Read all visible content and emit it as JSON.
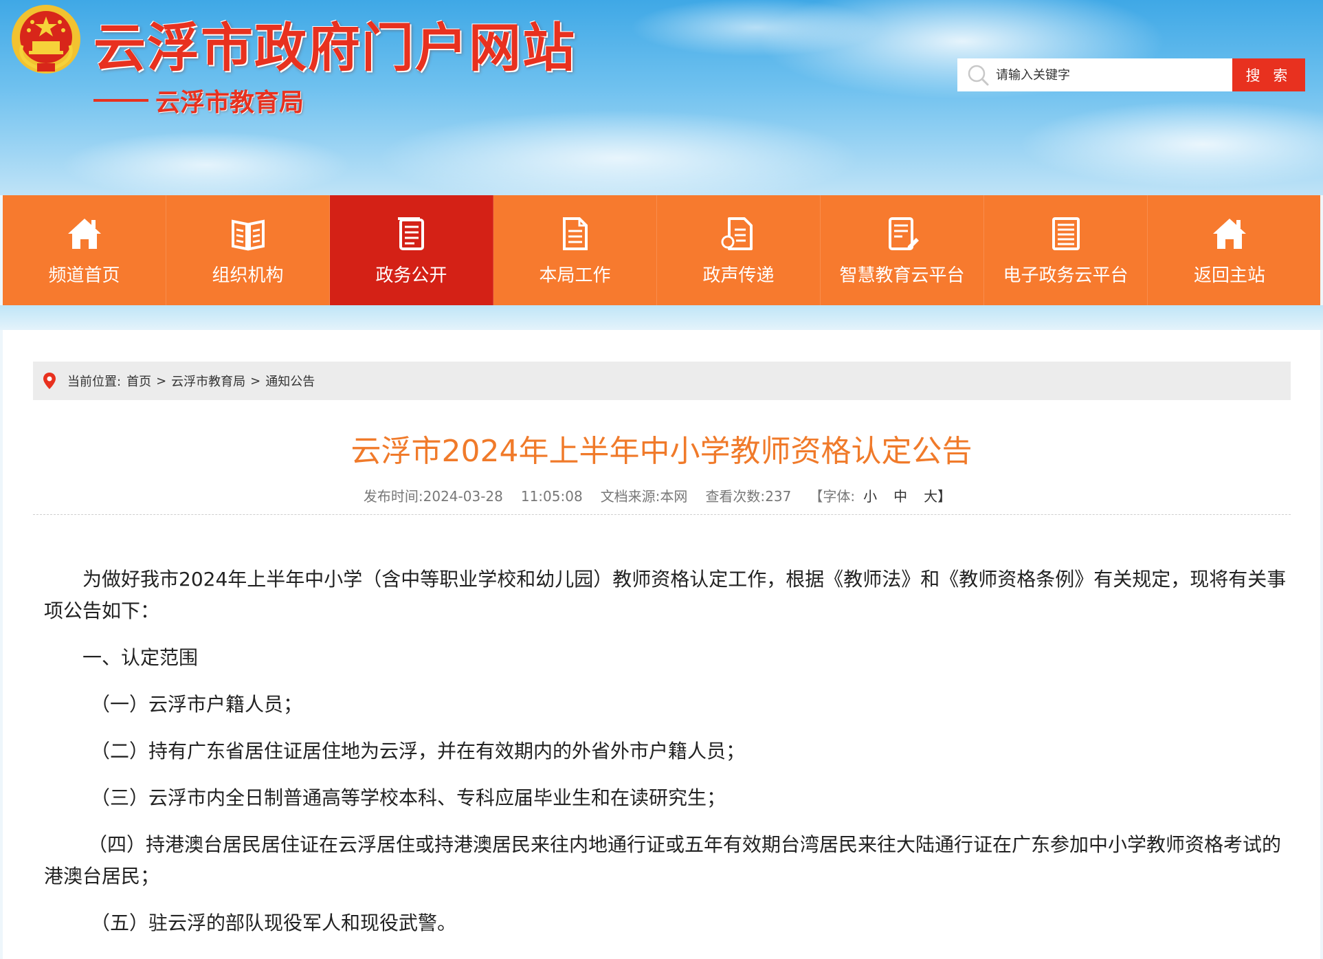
{
  "header": {
    "site_title": "云浮市政府门户网站",
    "sub_title": "云浮市教育局",
    "search": {
      "placeholder": "请输入关键字",
      "button_label": "搜 索"
    }
  },
  "nav": {
    "items": [
      {
        "label": "频道首页",
        "icon": "home-icon"
      },
      {
        "label": "组织机构",
        "icon": "book-icon"
      },
      {
        "label": "政务公开",
        "icon": "document-list-icon",
        "active": true
      },
      {
        "label": "本局工作",
        "icon": "file-icon"
      },
      {
        "label": "政声传递",
        "icon": "file-text-icon"
      },
      {
        "label": "智慧教育云平台",
        "icon": "edit-document-icon"
      },
      {
        "label": "电子政务云平台",
        "icon": "news-icon"
      },
      {
        "label": "返回主站",
        "icon": "home-icon"
      }
    ]
  },
  "breadcrumb": {
    "prefix": "当前位置:",
    "items": [
      "首页",
      "云浮市教育局",
      "通知公告"
    ],
    "separator": ">"
  },
  "article": {
    "title": "云浮市2024年上半年中小学教师资格认定公告",
    "meta": {
      "publish_label": "发布时间:",
      "publish_date": "2024-03-28",
      "publish_time": "11:05:08",
      "source_label": "文档来源:",
      "source": "本网",
      "views_label": "查看次数:",
      "views": "237",
      "font_label": "【字体:",
      "font_small": "小",
      "font_medium": "中",
      "font_large": "大】"
    },
    "paragraphs": [
      "为做好我市2024年上半年中小学（含中等职业学校和幼儿园）教师资格认定工作，根据《教师法》和《教师资格条例》有关规定，现将有关事项公告如下：",
      "一、认定范围",
      "（一）云浮市户籍人员；",
      "（二）持有广东省居住证居住地为云浮，并在有效期内的外省外市户籍人员；",
      "（三）云浮市内全日制普通高等学校本科、专科应届毕业生和在读研究生；",
      "（四）持港澳台居民居住证在云浮居住或持港澳居民来往内地通行证或五年有效期台湾居民来往大陆通行证在广东参加中小学教师资格考试的港澳台居民；",
      "（五）驻云浮的部队现役军人和现役武警。"
    ]
  },
  "colors": {
    "brand_red": "#e8311f",
    "nav_orange": "#f77a2e",
    "nav_active": "#d42116",
    "title_orange": "#f07a2a"
  }
}
